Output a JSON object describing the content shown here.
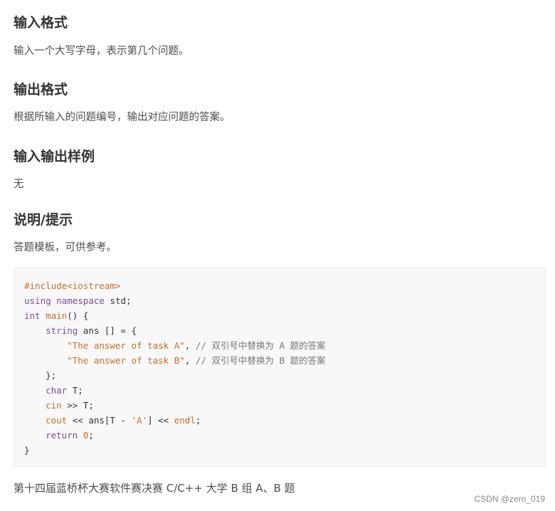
{
  "sections": [
    {
      "heading": "输入格式",
      "text": "输入一个大写字母，表示第几个问题。"
    },
    {
      "heading": "输出格式",
      "text": "根据所输入的问题编号，输出对应问题的答案。"
    },
    {
      "heading": "输入输出样例",
      "text": "无"
    },
    {
      "heading": "说明/提示",
      "text": "答题模板，可供参考。"
    }
  ],
  "code": {
    "line1": "#include<iostream>",
    "line2_kw1": "using",
    "line2_kw2": "namespace",
    "line2_rest": "std;",
    "line3_type": "int",
    "line3_fn": "main",
    "line3_rest": "() {",
    "line4_indent": "    ",
    "line4_type": "string",
    "line4_rest": " ans [] = {",
    "line5_indent": "        ",
    "line5_str": "\"The answer of task A\"",
    "line5_rest": ", ",
    "line5_cmt": "// 双引号中替换为 A 题的答案",
    "line6_indent": "        ",
    "line6_str": "\"The answer of task B\"",
    "line6_rest": ", ",
    "line6_cmt": "// 双引号中替换为 B 题的答案",
    "line7": "    };",
    "line8_indent": "    ",
    "line8_type": "char",
    "line8_rest": " T;",
    "line9_indent": "    ",
    "line9_fn": "cin",
    "line9_rest": " >> T;",
    "line10_indent": "    ",
    "line10_fn": "cout",
    "line10_mid": " << ans[T - ",
    "line10_str": "'A'",
    "line10_mid2": "] << ",
    "line10_fn2": "endl",
    "line10_end": ";",
    "line11_indent": "    ",
    "line11_kw": "return",
    "line11_sp": " ",
    "line11_num": "0",
    "line11_end": ";",
    "line12": "}"
  },
  "footer": "第十四届蓝桥杯大赛软件赛决赛 C/C++ 大学 B 组 A、B 题",
  "watermark": "CSDN @zero_019"
}
